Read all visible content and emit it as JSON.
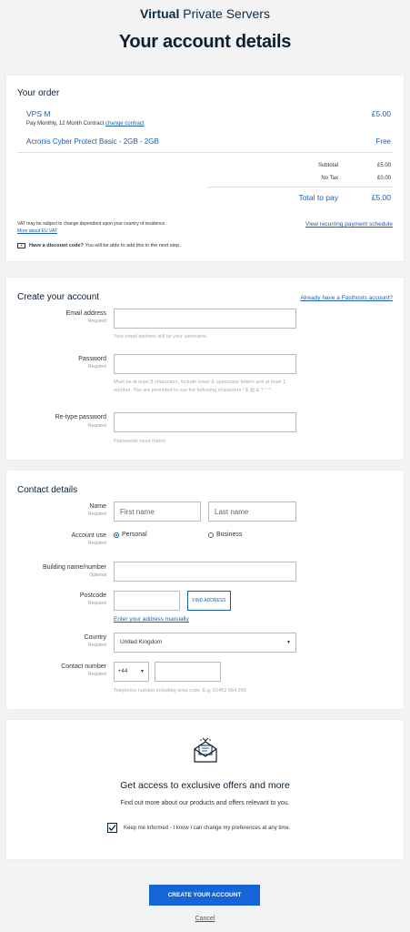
{
  "header": {
    "brand_bold": "Virtual",
    "brand_rest": "Private Servers",
    "title": "Your account details"
  },
  "order": {
    "title": "Your order",
    "product": "VPS M",
    "price": "£5.00",
    "contract": "Pay Monthly, 12 Month Contract",
    "change_link": "change contract",
    "addon": "Acronis Cyber Protect Basic - 2GB - 2GB",
    "addon_price": "Free",
    "subtotal_label": "Subtotal",
    "subtotal_value": "£5.00",
    "tax_label": "No Tax",
    "tax_value": "£0.00",
    "total_label": "Total to pay",
    "total_value": "£5.00",
    "vat_note": "VAT may be subject to change dependent upon your country of residence.",
    "vat_link": "More about EU VAT",
    "schedule_link": "View recurring payment schedule",
    "discount_bold": "Have a discount code?",
    "discount_rest": "You will be able to add this in the next step."
  },
  "account": {
    "title": "Create your account",
    "login_link": "Already have a Fasthosts account?",
    "email_label": "Email address",
    "email_req": "Required",
    "email_hint": "Your email address will be your username.",
    "password_label": "Password",
    "password_req": "Required",
    "password_hint": "Must be at least 8 characters, include lower & uppercase letters and at least 1 number. You are permitted to use the following characters ! $ @ & ? * ^",
    "retype_label": "Re-type password",
    "retype_req": "Required",
    "retype_hint": "Passwords must match."
  },
  "contact": {
    "title": "Contact details",
    "name_label": "Name",
    "name_req": "Required",
    "first_placeholder": "First name",
    "last_placeholder": "Last name",
    "use_label": "Account use",
    "use_req": "Required",
    "opt_personal": "Personal",
    "opt_business": "Business",
    "building_label": "Building name/number",
    "building_req": "Optional",
    "postcode_label": "Postcode",
    "postcode_req": "Required",
    "find_button": "FIND ADDRESS",
    "manual_link": "Enter your address manually",
    "country_label": "Country",
    "country_req": "Required",
    "country_value": "United Kingdom",
    "phone_label": "Contact number",
    "phone_req": "Required",
    "phone_code": "+44",
    "phone_hint": "Telephone number including area code. E.g. 01452 564 265"
  },
  "offers": {
    "title": "Get access to exclusive offers and more",
    "subtitle": "Find out more about our products and offers relevant to you.",
    "checkbox_label": "Keep me informed - I know I can change my preferences at any time.",
    "checked": true
  },
  "footer": {
    "create_button": "CREATE YOUR ACCOUNT",
    "cancel_link": "Cancel"
  },
  "colors": {
    "accent": "#1a5fb4",
    "button": "#1565d8",
    "title": "#0b1f33"
  }
}
